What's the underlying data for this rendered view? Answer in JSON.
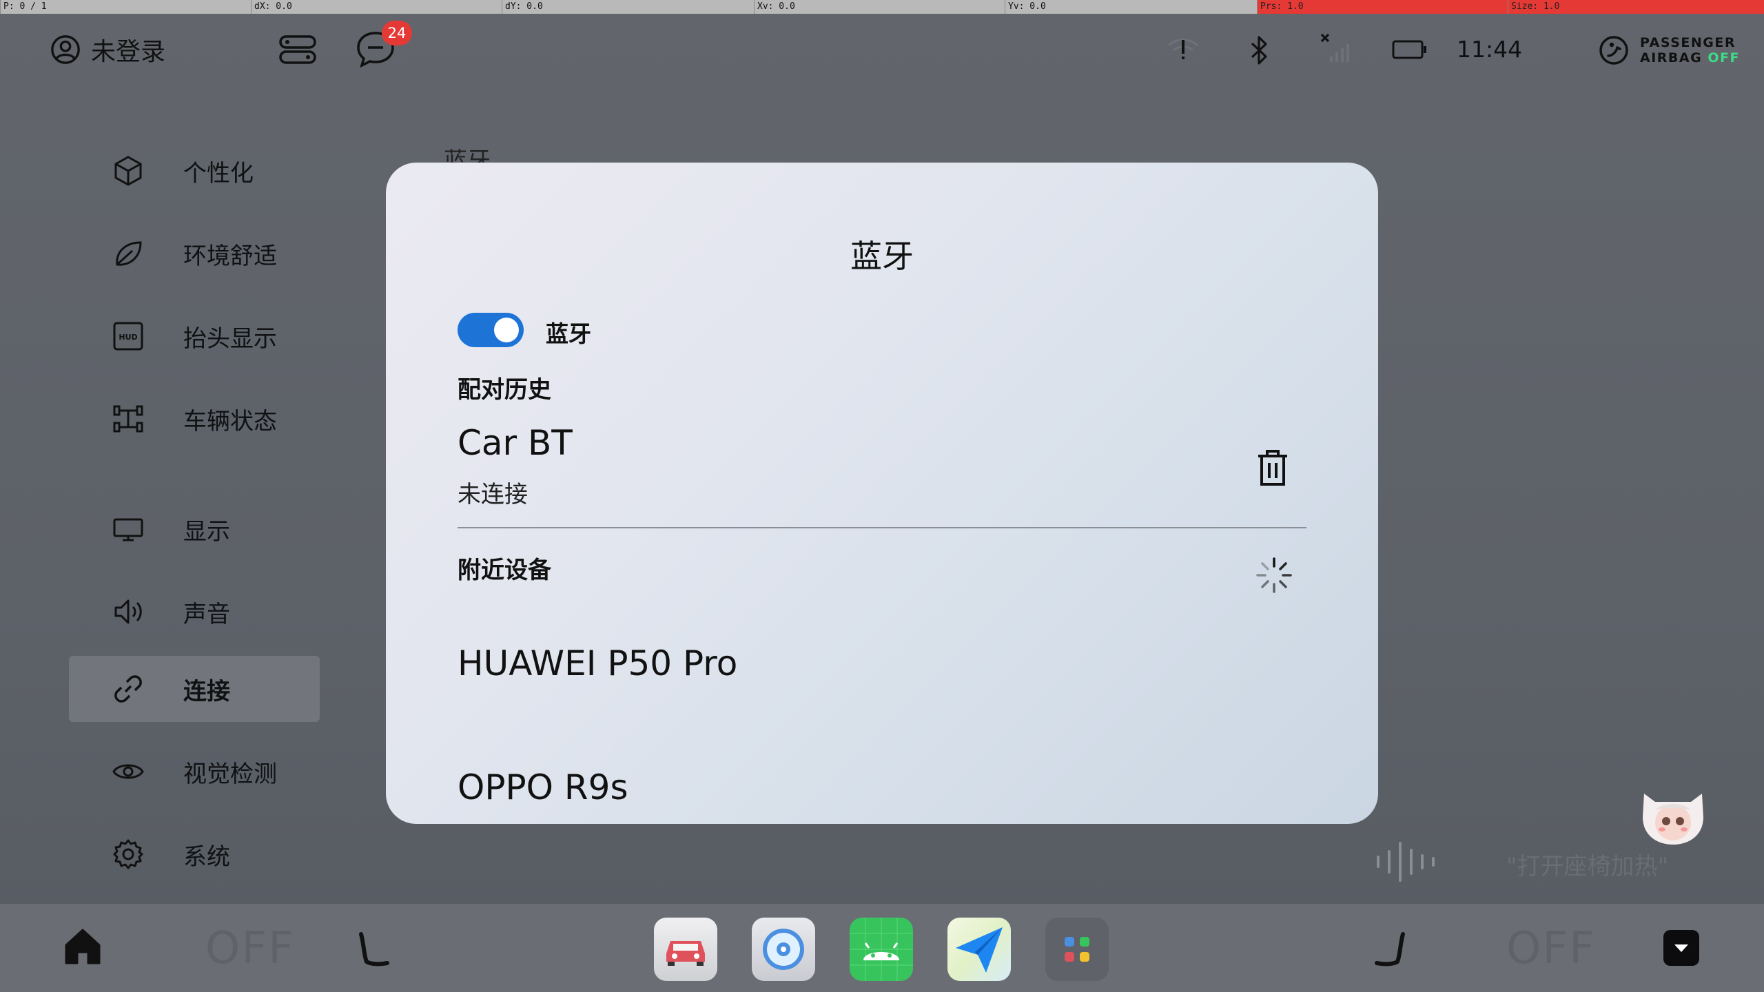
{
  "debug_bar": {
    "pointer": "P: 0 / 1",
    "dx": "dX: 0.0",
    "dy": "dY: 0.0",
    "xv": "Xv: 0.0",
    "yv": "Yv: 0.0",
    "prs": "Prs: 1.0",
    "size": "Size: 1.0"
  },
  "status_bar": {
    "user_label": "未登录",
    "message_badge": "24",
    "time": "11:44",
    "airbag_line1": "PASSENGER",
    "airbag_line2": "AIRBAG",
    "airbag_state": "OFF",
    "airbag_state_color": "#3ddc84"
  },
  "sidebar": {
    "items": [
      {
        "label": "个性化",
        "icon": "cube-icon"
      },
      {
        "label": "环境舒适",
        "icon": "leaf-icon"
      },
      {
        "label": "抬头显示",
        "icon": "hud-icon"
      },
      {
        "label": "车辆状态",
        "icon": "vehicle-status-icon"
      },
      {
        "label": "显示",
        "icon": "monitor-icon"
      },
      {
        "label": "声音",
        "icon": "speaker-icon"
      },
      {
        "label": "连接",
        "icon": "link-icon",
        "active": true
      },
      {
        "label": "视觉检测",
        "icon": "eye-icon"
      },
      {
        "label": "系统",
        "icon": "gear-icon"
      }
    ]
  },
  "background_title": "蓝牙",
  "dialog": {
    "title": "蓝牙",
    "toggle_label": "蓝牙",
    "toggle_on": true,
    "history_header": "配对历史",
    "history_devices": [
      {
        "name": "Car BT",
        "status": "未连接"
      }
    ],
    "nearby_header": "附近设备",
    "nearby_devices": [
      "HUAWEI P50 Pro",
      "OPPO R9s"
    ],
    "accent": "#1e74d6"
  },
  "voice": {
    "hint": "\"打开座椅加热\""
  },
  "dock": {
    "seat_left_state": "OFF",
    "seat_right_state": "OFF",
    "apps": [
      "car-app-icon",
      "music-disc-app-icon",
      "android-app-icon",
      "send-app-icon",
      "app-grid-icon"
    ]
  }
}
